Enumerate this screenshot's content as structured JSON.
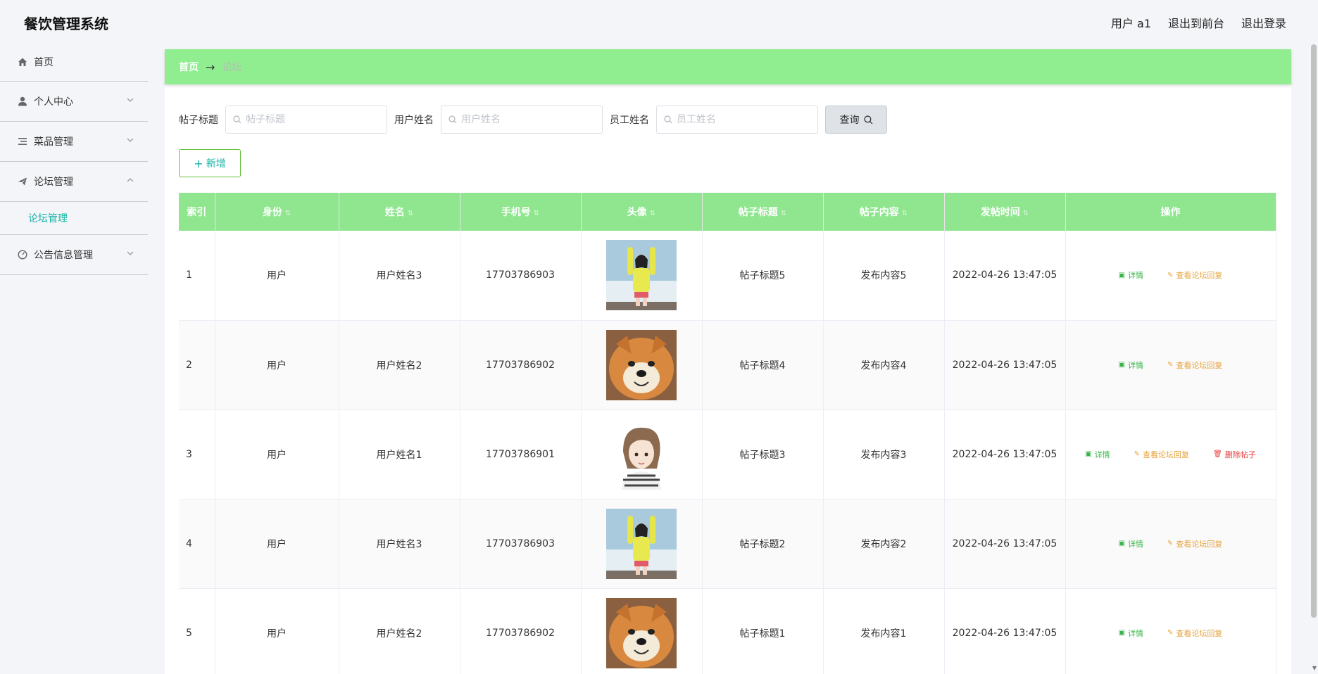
{
  "app": {
    "title": "餐饮管理系统"
  },
  "header": {
    "user": "用户 a1",
    "to_front": "退出到前台",
    "logout": "退出登录"
  },
  "sidebar": {
    "items": [
      {
        "label": "首页",
        "icon": "home-icon"
      },
      {
        "label": "个人中心",
        "icon": "user-icon"
      },
      {
        "label": "菜品管理",
        "icon": "list-icon"
      },
      {
        "label": "论坛管理",
        "icon": "send-icon"
      },
      {
        "label": "公告信息管理",
        "icon": "gauge-icon"
      }
    ],
    "subitem": "论坛管理"
  },
  "breadcrumb": {
    "home": "首页",
    "current": "论坛"
  },
  "filters": {
    "title_label": "帖子标题",
    "title_placeholder": "帖子标题",
    "user_label": "用户姓名",
    "user_placeholder": "用户姓名",
    "staff_label": "员工姓名",
    "staff_placeholder": "员工姓名",
    "query": "查询"
  },
  "add_button": "新增",
  "table": {
    "headers": [
      "索引",
      "身份",
      "姓名",
      "手机号",
      "头像",
      "帖子标题",
      "帖子内容",
      "发帖时间",
      "操作"
    ],
    "actions": {
      "detail": "详情",
      "reply": "查看论坛回复",
      "delete": "删除帖子"
    },
    "rows": [
      {
        "index": "1",
        "role": "用户",
        "name": "用户姓名3",
        "phone": "17703786903",
        "avatar": "girl-yellow-photo",
        "title": "帖子标题5",
        "content": "发布内容5",
        "time": "2022-04-26 13:47:05"
      },
      {
        "index": "2",
        "role": "用户",
        "name": "用户姓名2",
        "phone": "17703786902",
        "avatar": "shiba-dog-photo",
        "title": "帖子标题4",
        "content": "发布内容4",
        "time": "2022-04-26 13:47:05"
      },
      {
        "index": "3",
        "role": "用户",
        "name": "用户姓名1",
        "phone": "17703786901",
        "avatar": "cartoon-girl-illustration",
        "title": "帖子标题3",
        "content": "发布内容3",
        "time": "2022-04-26 13:47:05"
      },
      {
        "index": "4",
        "role": "用户",
        "name": "用户姓名3",
        "phone": "17703786903",
        "avatar": "girl-yellow-photo",
        "title": "帖子标题2",
        "content": "发布内容2",
        "time": "2022-04-26 13:47:05"
      },
      {
        "index": "5",
        "role": "用户",
        "name": "用户姓名2",
        "phone": "17703786902",
        "avatar": "shiba-dog-photo",
        "title": "帖子标题1",
        "content": "发布内容1",
        "time": "2022-04-26 13:47:05"
      }
    ]
  },
  "colors": {
    "accent_green": "#90ee90",
    "teal": "#15b3a6",
    "detail": "#3bb34a",
    "reply": "#e6a23c",
    "delete": "#e53c3c"
  }
}
